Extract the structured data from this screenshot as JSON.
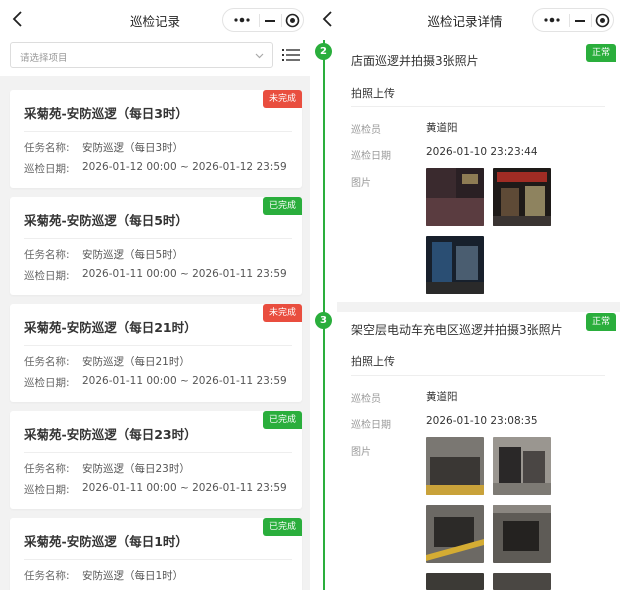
{
  "list_screen": {
    "title": "巡检记录",
    "filter_placeholder": "请选择项目",
    "labels": {
      "task_name": "任务名称:",
      "date": "巡检日期:"
    },
    "cards": [
      {
        "title": "采菊苑-安防巡逻（每日3时）",
        "task": "安防巡逻（每日3时）",
        "date": "2026-01-12 00:00 ~ 2026-01-12 23:59",
        "status": "未完成",
        "status_color": "#e94e3f"
      },
      {
        "title": "采菊苑-安防巡逻（每日5时）",
        "task": "安防巡逻（每日5时）",
        "date": "2026-01-11 00:00 ~ 2026-01-11 23:59",
        "status": "已完成",
        "status_color": "#2aae3c"
      },
      {
        "title": "采菊苑-安防巡逻（每日21时）",
        "task": "安防巡逻（每日21时）",
        "date": "2026-01-11 00:00 ~ 2026-01-11 23:59",
        "status": "未完成",
        "status_color": "#e94e3f"
      },
      {
        "title": "采菊苑-安防巡逻（每日23时）",
        "task": "安防巡逻（每日23时）",
        "date": "2026-01-11 00:00 ~ 2026-01-11 23:59",
        "status": "已完成",
        "status_color": "#2aae3c"
      },
      {
        "title": "采菊苑-安防巡逻（每日1时）",
        "task": "安防巡逻（每日1时）",
        "date": "",
        "status": "已完成",
        "status_color": "#2aae3c"
      }
    ]
  },
  "detail_screen": {
    "title": "巡检记录详情",
    "labels": {
      "inspector": "巡检员",
      "date": "巡检日期",
      "images": "图片"
    },
    "items": [
      {
        "step": "2",
        "title": "店面巡逻并拍摄3张照片",
        "status": "正常",
        "subtitle": "拍照上传",
        "inspector": "黄道阳",
        "date": "2026-01-10 23:23:44"
      },
      {
        "step": "3",
        "title": "架空层电动车充电区巡逻并拍摄3张照片",
        "status": "正常",
        "subtitle": "拍照上传",
        "inspector": "黄道阳",
        "date": "2026-01-10 23:08:35"
      }
    ]
  },
  "icons": [
    "back-arrow-icon",
    "more-dots-icon",
    "minimize-icon",
    "target-icon",
    "chevron-down-icon",
    "list-filter-icon"
  ],
  "colors": {
    "success": "#2aae3c",
    "danger": "#e94e3f",
    "background": "#f2f2f2"
  }
}
